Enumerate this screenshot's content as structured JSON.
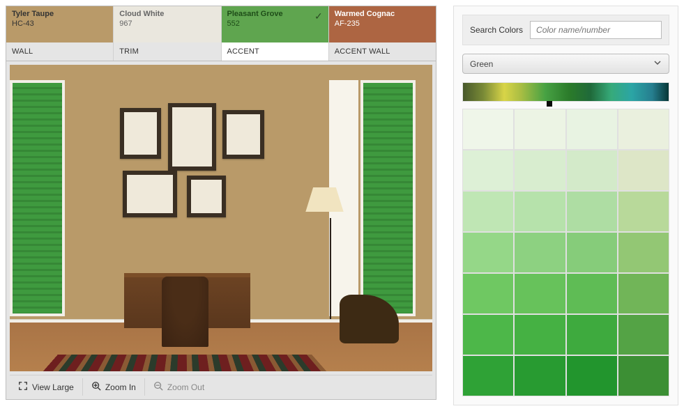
{
  "swatches": [
    {
      "name": "Tyler Taupe",
      "code": "HC-43",
      "role": "WALL",
      "color": "#B99A69",
      "text": "#333333",
      "selected": false
    },
    {
      "name": "Cloud White",
      "code": "967",
      "role": "TRIM",
      "color": "#EAE7DE",
      "text": "#666666",
      "selected": false
    },
    {
      "name": "Pleasant Grove",
      "code": "552",
      "role": "ACCENT",
      "color": "#5FA54F",
      "text": "#1e4d18",
      "selected": true
    },
    {
      "name": "Warmed Cognac",
      "code": "AF-235",
      "role": "ACCENT WALL",
      "color": "#AD6542",
      "text": "#ffffff",
      "selected": false
    }
  ],
  "toolbar": {
    "view_large": "View Large",
    "zoom_in": "Zoom In",
    "zoom_out": "Zoom Out"
  },
  "search": {
    "label": "Search Colors",
    "placeholder": "Color name/number"
  },
  "filter": {
    "selected": "Green"
  },
  "spectrum_pick_pct": 42,
  "palette": [
    "#EFF6E9",
    "#ECF4E4",
    "#E8F3E2",
    "#EAF0DE",
    "#DDF0D6",
    "#D8EDCF",
    "#D3EAC9",
    "#DDE6C7",
    "#BFE6B4",
    "#B6E2AB",
    "#AEDDA3",
    "#B8D99A",
    "#95D788",
    "#8DD181",
    "#86CC7A",
    "#93C774",
    "#6FC862",
    "#67C25B",
    "#5FBC55",
    "#71B558",
    "#4DB749",
    "#45B143",
    "#3EAA3E",
    "#54A345",
    "#2FA236",
    "#289B31",
    "#22952D",
    "#3C8F34"
  ]
}
